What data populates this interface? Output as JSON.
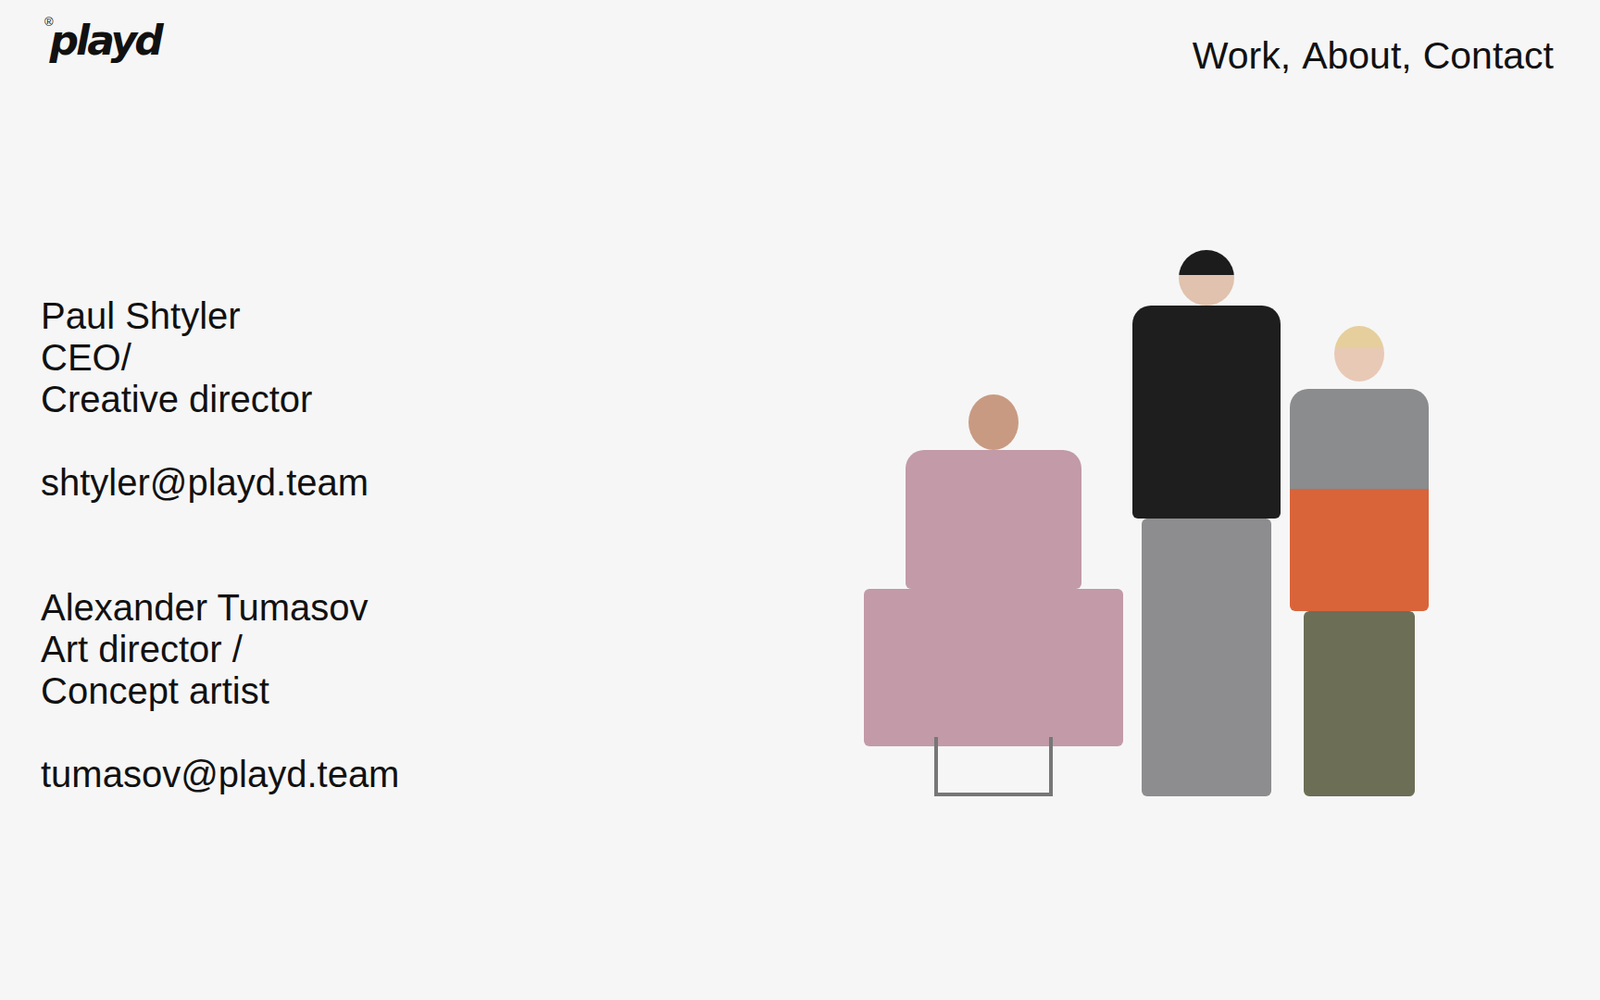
{
  "header": {
    "logo": {
      "text": "playd",
      "mark": "®"
    },
    "nav": [
      "Work,",
      "About,",
      "Contact"
    ]
  },
  "contacts": [
    {
      "name": "Paul Shtyler",
      "roles": [
        "CEO/",
        "Creative director"
      ],
      "email": "shtyler@playd.team"
    },
    {
      "name": "Alexander Tumasov",
      "roles": [
        "Art director /",
        "Concept artist"
      ],
      "email": "tumasov@playd.team"
    }
  ],
  "photo": {
    "kind": "photograph"
  }
}
